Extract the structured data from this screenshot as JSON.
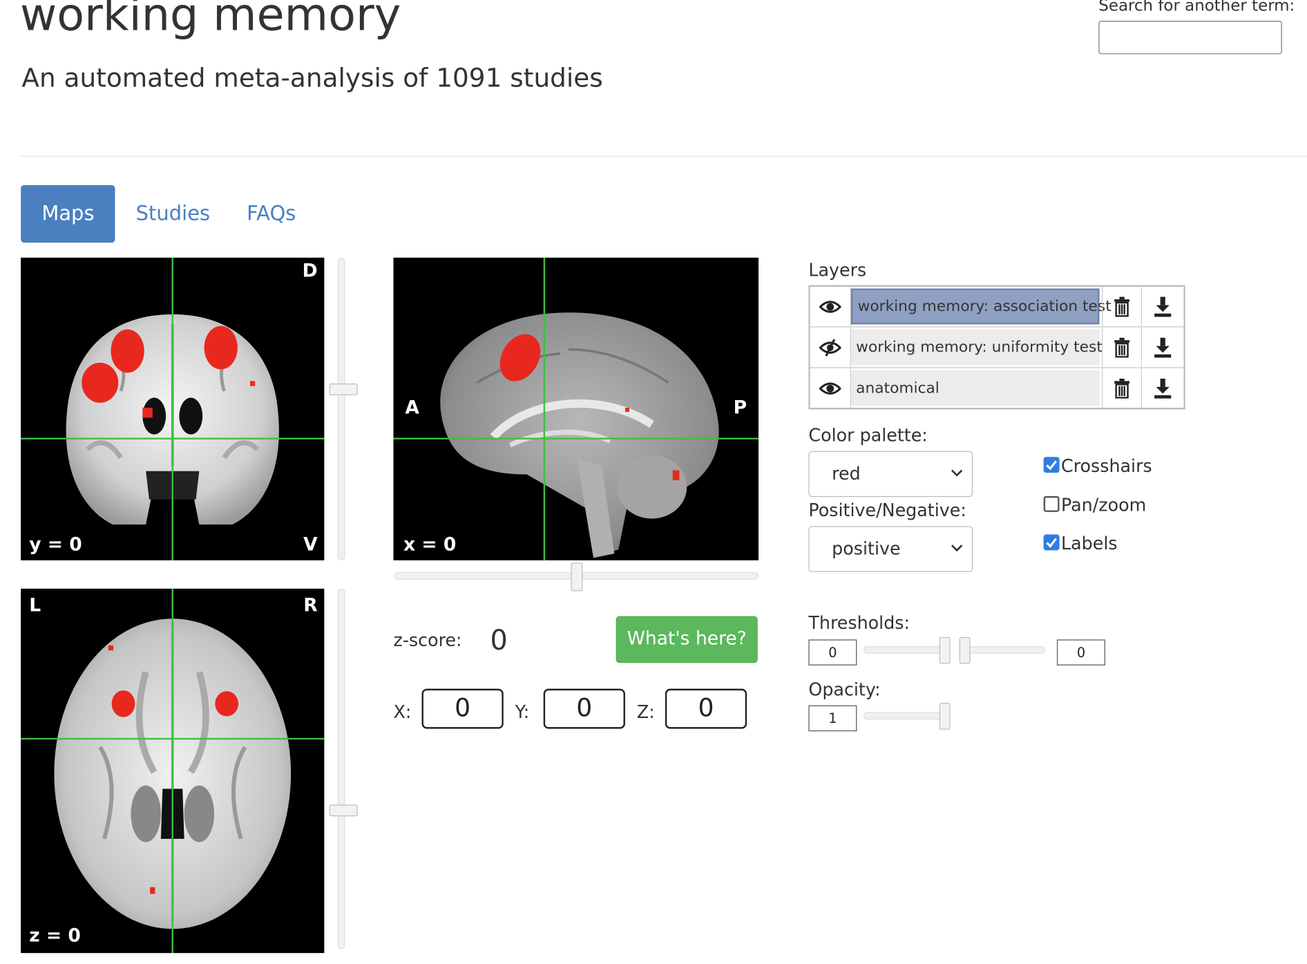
{
  "header": {
    "title": "working memory",
    "subtitle": "An automated meta-analysis of 1091 studies",
    "search_label": "Search for another term:",
    "search_value": ""
  },
  "tabs": [
    {
      "label": "Maps",
      "active": true
    },
    {
      "label": "Studies",
      "active": false
    },
    {
      "label": "FAQs",
      "active": false
    }
  ],
  "viewer": {
    "coronal": {
      "slice_label": "y = 0",
      "top_right": "D",
      "bottom_right": "V"
    },
    "sagittal": {
      "slice_label": "x = 0",
      "left": "A",
      "right": "P"
    },
    "axial": {
      "slice_label": "z = 0",
      "top_left": "L",
      "top_right": "R"
    },
    "crosshair_color": "#3fbf3f",
    "activation_color": "#e8281e"
  },
  "zscore": {
    "label": "z-score:",
    "value": "0"
  },
  "whats_here_label": "What's here?",
  "coords": {
    "x_label": "X:",
    "x": "0",
    "y_label": "Y:",
    "y": "0",
    "z_label": "Z:",
    "z": "0"
  },
  "layers": {
    "title": "Layers",
    "items": [
      {
        "name": "working memory: association test",
        "visible_icon": "eye-icon",
        "active": true
      },
      {
        "name": "working memory: uniformity test",
        "visible_icon": "eye-slash-icon",
        "active": false
      },
      {
        "name": "anatomical",
        "visible_icon": "eye-icon",
        "active": false
      }
    ]
  },
  "options": {
    "color_palette_label": "Color palette:",
    "color_palette_value": "red",
    "pos_neg_label": "Positive/Negative:",
    "pos_neg_value": "positive",
    "crosshairs_label": "Crosshairs",
    "crosshairs": true,
    "panzoom_label": "Pan/zoom",
    "panzoom": false,
    "labels_label": "Labels",
    "labels": true
  },
  "thresholds": {
    "label": "Thresholds:",
    "low": "0",
    "high": "0"
  },
  "opacity": {
    "label": "Opacity:",
    "value": "1"
  }
}
